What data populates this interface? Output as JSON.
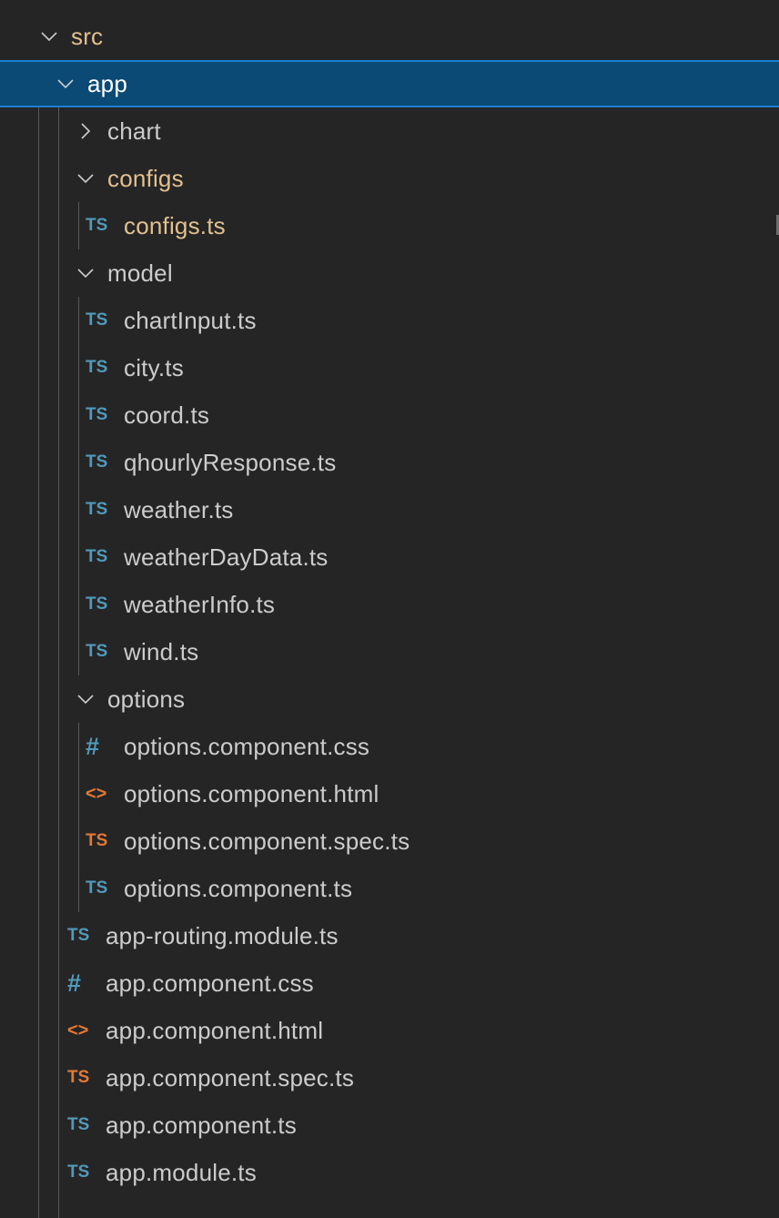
{
  "explorer": {
    "root": {
      "label": "src",
      "expanded": true
    },
    "items": [
      {
        "label": "app",
        "type": "folder",
        "expanded": true,
        "selected": true
      },
      {
        "label": "chart",
        "type": "folder",
        "expanded": false
      },
      {
        "label": "configs",
        "type": "folder",
        "expanded": true,
        "modified": true
      },
      {
        "label": "configs.ts",
        "type": "ts",
        "icon": "TS",
        "modified": true
      },
      {
        "label": "model",
        "type": "folder",
        "expanded": true
      },
      {
        "label": "chartInput.ts",
        "type": "ts",
        "icon": "TS"
      },
      {
        "label": "city.ts",
        "type": "ts",
        "icon": "TS"
      },
      {
        "label": "coord.ts",
        "type": "ts",
        "icon": "TS"
      },
      {
        "label": "qhourlyResponse.ts",
        "type": "ts",
        "icon": "TS"
      },
      {
        "label": "weather.ts",
        "type": "ts",
        "icon": "TS"
      },
      {
        "label": "weatherDayData.ts",
        "type": "ts",
        "icon": "TS"
      },
      {
        "label": "weatherInfo.ts",
        "type": "ts",
        "icon": "TS"
      },
      {
        "label": "wind.ts",
        "type": "ts",
        "icon": "TS"
      },
      {
        "label": "options",
        "type": "folder",
        "expanded": true
      },
      {
        "label": "options.component.css",
        "type": "css",
        "icon": "#"
      },
      {
        "label": "options.component.html",
        "type": "html",
        "icon": "<>"
      },
      {
        "label": "options.component.spec.ts",
        "type": "ts-spec",
        "icon": "TS"
      },
      {
        "label": "options.component.ts",
        "type": "ts",
        "icon": "TS"
      },
      {
        "label": "app-routing.module.ts",
        "type": "ts",
        "icon": "TS"
      },
      {
        "label": "app.component.css",
        "type": "css",
        "icon": "#"
      },
      {
        "label": "app.component.html",
        "type": "html",
        "icon": "<>"
      },
      {
        "label": "app.component.spec.ts",
        "type": "ts-spec",
        "icon": "TS"
      },
      {
        "label": "app.component.ts",
        "type": "ts",
        "icon": "TS"
      },
      {
        "label": "app.module.ts",
        "type": "ts",
        "icon": "TS"
      }
    ]
  },
  "colors": {
    "background": "#252526",
    "selection": "#0b4a75",
    "selection_border": "#1a7fd1",
    "label": "#cccccc",
    "modified": "#e2c08d",
    "ts_icon": "#519aba",
    "spec_icon": "#e37933"
  }
}
